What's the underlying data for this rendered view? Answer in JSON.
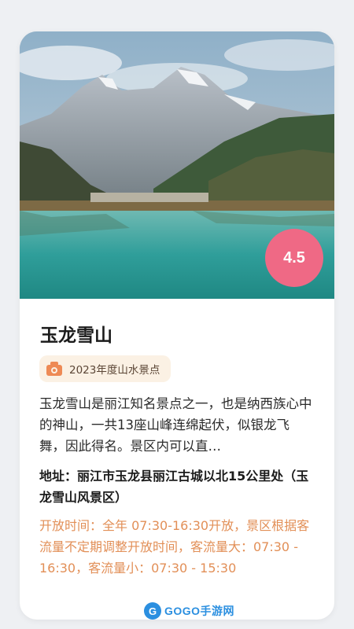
{
  "attraction": {
    "name": "玉龙雪山",
    "rating": "4.5",
    "badge_label": "2023年度山水景点",
    "description": "玉龙雪山是丽江知名景点之一，也是纳西族心中的神山，一共13座山峰连绵起伏，似银龙飞舞，因此得名。景区内可以直…",
    "address": "地址：丽江市玉龙县丽江古城以北15公里处（玉龙雪山风景区）",
    "hours": "开放时间：全年 07:30-16:30开放，景区根据客流量不定期调整开放时间，客流量大：07:30 - 16:30，客流量小：07:30 - 15:30"
  },
  "watermark": {
    "text": "GOGO手游网"
  },
  "colors": {
    "rating_badge": "#ef6985",
    "badge_bg": "#fbf1e4",
    "badge_icon": "#ee8a55",
    "hours_text": "#e28f57",
    "watermark": "#2b8fe0"
  }
}
